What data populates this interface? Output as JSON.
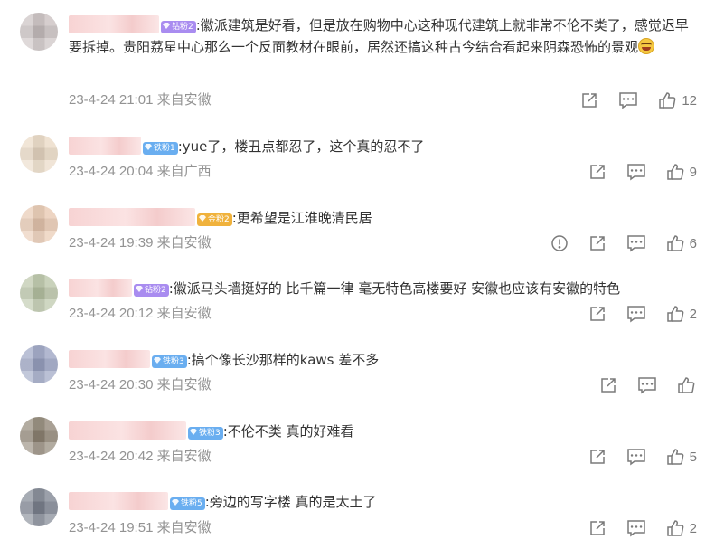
{
  "comments": [
    {
      "badge": "钻粉2",
      "badge_color": "#a98cf0",
      "text": ":徽派建筑是好看，但是放在购物中心这种现代建筑上就非常不伦不类了，感觉迟早要拆掉。贵阳荔星中心那么一个反面教材在眼前，居然还搞这种古今结合看起来阴森恐怖的景观",
      "has_emoji": true,
      "emoji_name": "laugh-cry-emoji",
      "time": "23-4-24 21:01",
      "location": "来自安徽",
      "like_count": "12",
      "show_report": false,
      "avatar_color": "#c9c0c0"
    },
    {
      "badge": "铁粉1",
      "badge_color": "#6aaef0",
      "text": ":yue了，楼丑点都忍了，这个真的忍不了",
      "time": "23-4-24 20:04",
      "location": "来自广西",
      "like_count": "9",
      "show_report": false,
      "avatar_color": "#ead9c4"
    },
    {
      "badge": "金粉2",
      "badge_color": "#f0b23c",
      "text": ":更希望是江淮晚清民居",
      "time": "23-4-24 19:39",
      "location": "来自安徽",
      "like_count": "6",
      "show_report": true,
      "avatar_color": "#e8c8b0"
    },
    {
      "badge": "钻粉2",
      "badge_color": "#a98cf0",
      "text": ":徽派马头墙挺好的 比千篇一律 毫无特色高楼要好 安徽也应该有安徽的特色",
      "time": "23-4-24 20:12",
      "location": "来自安徽",
      "like_count": "2",
      "show_report": false,
      "avatar_color": "#b9c4a6"
    },
    {
      "badge": "铁粉3",
      "badge_color": "#6aaef0",
      "text": ":搞个像长沙那样的kaws 差不多",
      "time": "23-4-24 20:30",
      "location": "来自安徽",
      "like_count": "",
      "show_report": false,
      "avatar_color": "#9aa3c2"
    },
    {
      "badge": "铁粉3",
      "badge_color": "#6aaef0",
      "text": ":不伦不类 真的好难看",
      "time": "23-4-24 20:42",
      "location": "来自安徽",
      "like_count": "5",
      "show_report": false,
      "avatar_color": "#8f8474"
    },
    {
      "badge": "铁粉5",
      "badge_color": "#6aaef0",
      "text": ":旁边的写字楼 真的是太土了",
      "time": "23-4-24 19:51",
      "location": "来自安徽",
      "like_count": "2",
      "show_report": false,
      "avatar_color": "#7d8390"
    }
  ]
}
